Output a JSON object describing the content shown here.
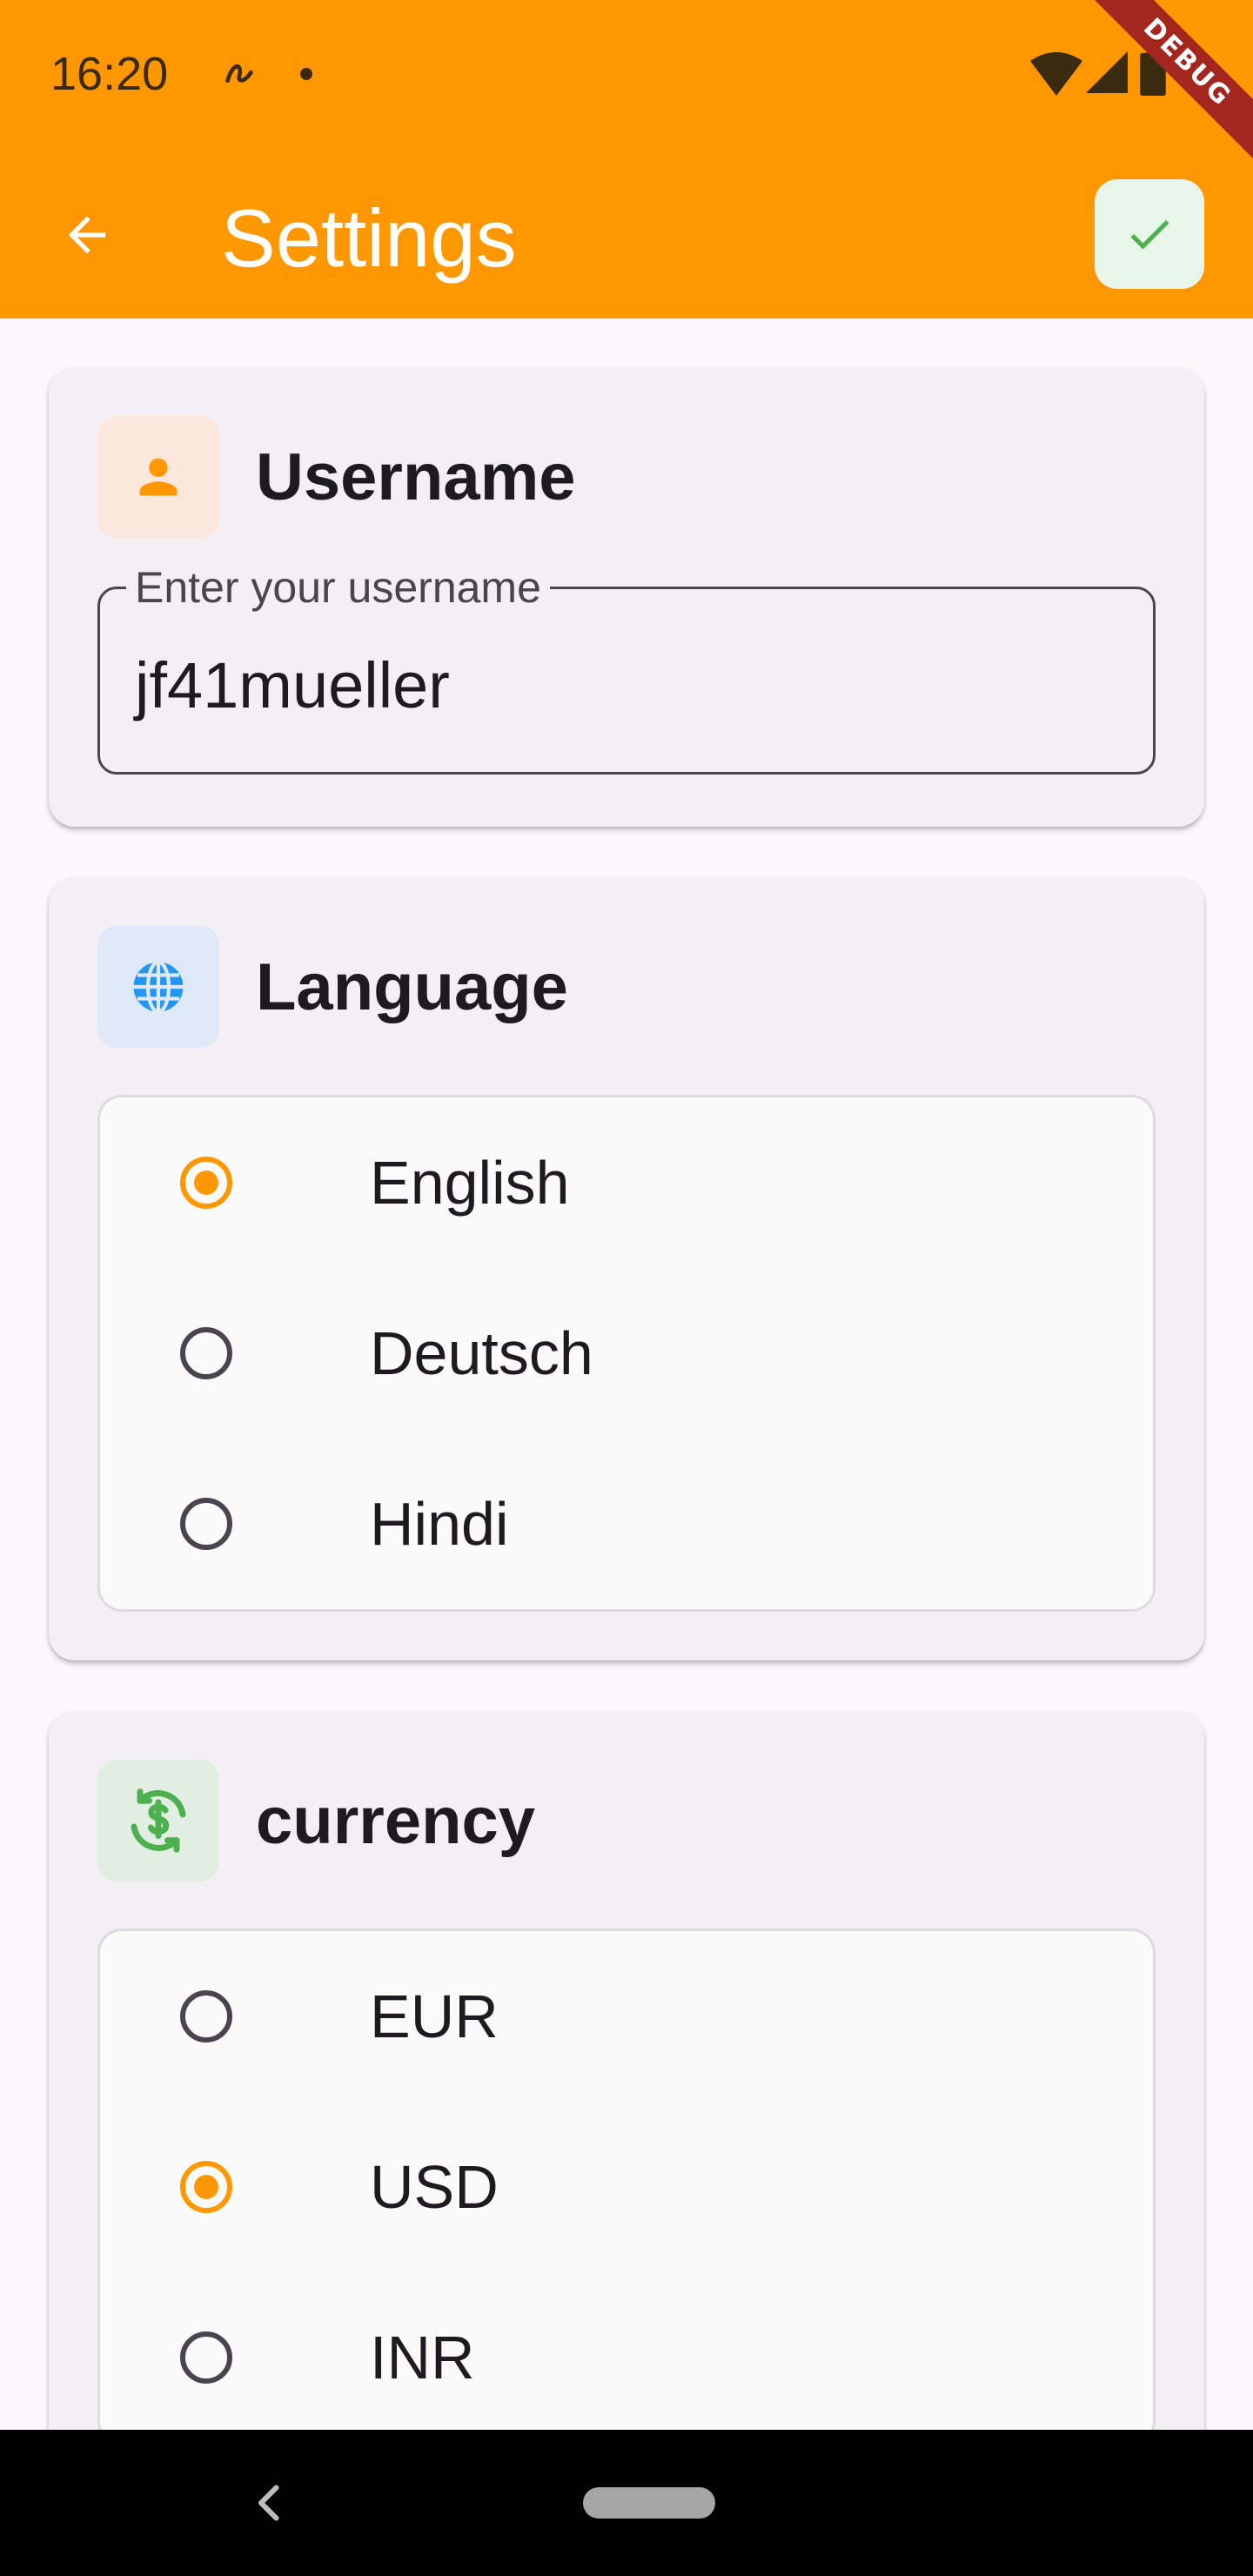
{
  "status_bar": {
    "time": "16:20",
    "debug_label": "DEBUG"
  },
  "toolbar": {
    "title": "Settings",
    "back_icon": "arrow-left-icon",
    "save_icon": "check-icon"
  },
  "colors": {
    "app_bar": "#ff9800",
    "accent": "#ff9800",
    "save_icon": "#4caf50",
    "user_icon": "#ff9800",
    "language_icon": "#2196f3",
    "currency_icon": "#4caf50"
  },
  "username_card": {
    "title": "Username",
    "icon": "person-icon",
    "field_label": "Enter your username",
    "field_value": "jf41mueller"
  },
  "language_card": {
    "title": "Language",
    "icon": "globe-icon",
    "options": [
      {
        "label": "English",
        "selected": true
      },
      {
        "label": "Deutsch",
        "selected": false
      },
      {
        "label": "Hindi",
        "selected": false
      }
    ]
  },
  "currency_card": {
    "title": "currency",
    "icon": "currency-exchange-icon",
    "options": [
      {
        "label": "EUR",
        "selected": false
      },
      {
        "label": "USD",
        "selected": true
      },
      {
        "label": "INR",
        "selected": false
      }
    ]
  }
}
